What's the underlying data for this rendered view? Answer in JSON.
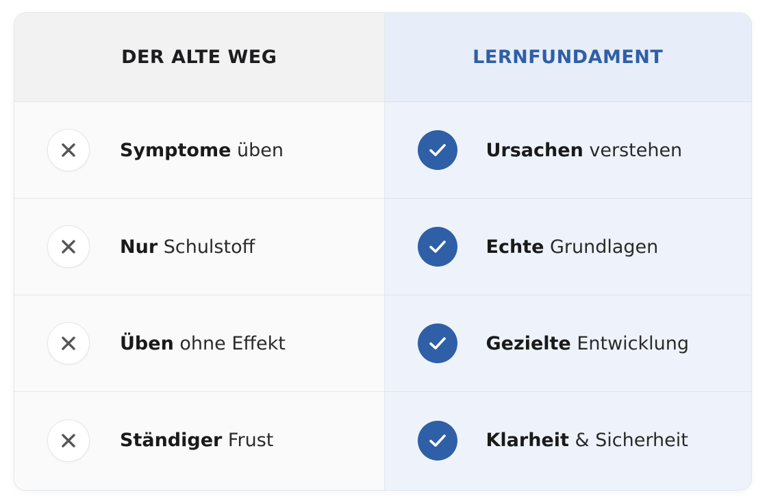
{
  "left": {
    "title": "DER ALTE WEG",
    "icon": "x-icon",
    "items": [
      {
        "strong": "Symptome",
        "rest": " üben"
      },
      {
        "strong": "Nur",
        "rest": " Schulstoff"
      },
      {
        "strong": "Üben",
        "rest": " ohne Effekt"
      },
      {
        "strong": "Ständiger",
        "rest": " Frust"
      }
    ]
  },
  "right": {
    "title": "LERNFUNDAMENT",
    "icon": "check-icon",
    "items": [
      {
        "strong": "Ursachen",
        "rest": " verstehen"
      },
      {
        "strong": "Echte",
        "rest": " Grundlagen"
      },
      {
        "strong": "Gezielte",
        "rest": " Entwicklung"
      },
      {
        "strong": "Klarheit",
        "rest": " & Sicherheit"
      }
    ]
  },
  "colors": {
    "accent": "#2f5fa6",
    "left_bg": "#fafafa",
    "right_bg": "#eef3fb"
  }
}
